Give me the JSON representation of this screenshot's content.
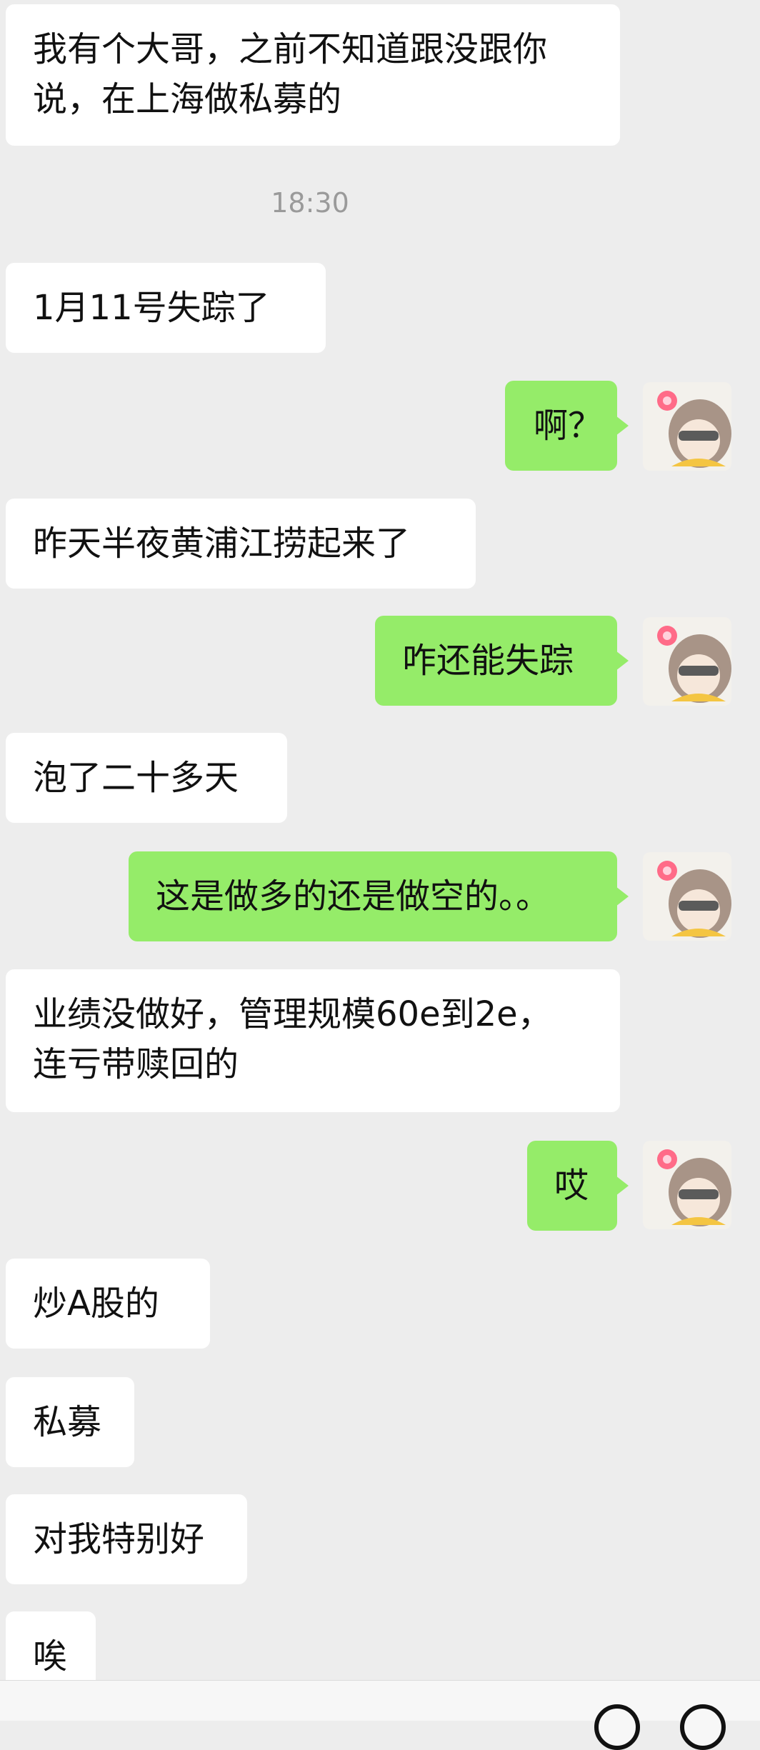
{
  "chat": {
    "timestamp": "18:30",
    "messages": [
      {
        "side": "left",
        "text": "我有个大哥，之前不知道跟没跟你\n说，在上海做私募的"
      },
      {
        "side": "left",
        "text": "1月11号失踪了"
      },
      {
        "side": "right",
        "text": "啊？"
      },
      {
        "side": "left",
        "text": "昨天半夜黄浦江捞起来了"
      },
      {
        "side": "right",
        "text": "咋还能失踪"
      },
      {
        "side": "left",
        "text": "泡了二十多天"
      },
      {
        "side": "right",
        "text": "这是做多的还是做空的。。"
      },
      {
        "side": "left",
        "text": "业绩没做好，管理规模60e到2e，\n连亏带赎回的"
      },
      {
        "side": "right",
        "text": "哎"
      },
      {
        "side": "left",
        "text": "炒A股的"
      },
      {
        "side": "left",
        "text": "私募"
      },
      {
        "side": "left",
        "text": "对我特别好"
      },
      {
        "side": "left",
        "text": "唉"
      }
    ]
  },
  "avatar": {
    "icon": "anime-girl-avatar-icon"
  },
  "colors": {
    "background": "#ededed",
    "received_bubble": "#ffffff",
    "sent_bubble": "#95ec69",
    "timestamp": "#9a9a9a"
  }
}
